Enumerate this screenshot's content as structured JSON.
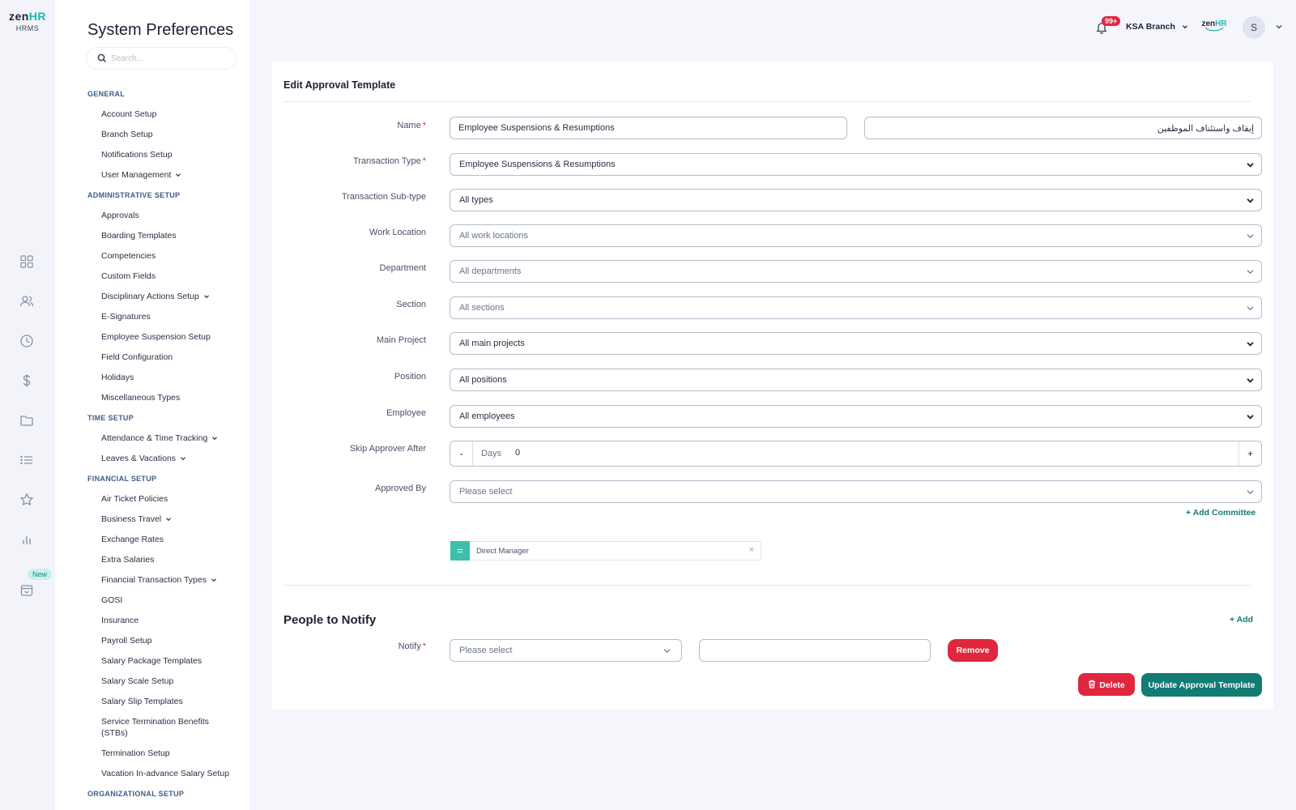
{
  "brand": {
    "logo_main": "zen",
    "logo_accent": "HR",
    "logo_sub": "HRMS",
    "accent_color": "#1bb8b0",
    "primary_button_color": "#127c74",
    "danger_color": "#e0273e"
  },
  "rail": {
    "icons": [
      "dashboard-icon",
      "people-icon",
      "clock-icon",
      "dollar-icon",
      "folder-icon",
      "list-icon",
      "star-icon",
      "bar-chart-icon",
      "inbox-icon"
    ],
    "new_badge": "New"
  },
  "settings": {
    "title": "System Preferences",
    "search_placeholder": "Search...",
    "sections": [
      {
        "heading": "GENERAL",
        "items": [
          {
            "label": "Account Setup"
          },
          {
            "label": "Branch Setup"
          },
          {
            "label": "Notifications Setup"
          },
          {
            "label": "User Management",
            "expandable": true
          }
        ]
      },
      {
        "heading": "ADMINISTRATIVE SETUP",
        "items": [
          {
            "label": "Approvals"
          },
          {
            "label": "Boarding Templates"
          },
          {
            "label": "Competencies"
          },
          {
            "label": "Custom Fields"
          },
          {
            "label": "Disciplinary Actions Setup",
            "expandable": true
          },
          {
            "label": "E-Signatures"
          },
          {
            "label": "Employee Suspension Setup"
          },
          {
            "label": "Field Configuration"
          },
          {
            "label": "Holidays"
          },
          {
            "label": "Miscellaneous Types"
          }
        ]
      },
      {
        "heading": "TIME SETUP",
        "items": [
          {
            "label": "Attendance & Time Tracking",
            "expandable": true
          },
          {
            "label": "Leaves & Vacations",
            "expandable": true
          }
        ]
      },
      {
        "heading": "FINANCIAL SETUP",
        "items": [
          {
            "label": "Air Ticket Policies"
          },
          {
            "label": "Business Travel",
            "expandable": true
          },
          {
            "label": "Exchange Rates"
          },
          {
            "label": "Extra Salaries"
          },
          {
            "label": "Financial Transaction Types",
            "expandable": true
          },
          {
            "label": "GOSI"
          },
          {
            "label": "Insurance"
          },
          {
            "label": "Payroll Setup"
          },
          {
            "label": "Salary Package Templates"
          },
          {
            "label": "Salary Scale Setup"
          },
          {
            "label": "Salary Slip Templates"
          },
          {
            "label": "Service Termination Benefits (STBs)",
            "multiline": true
          },
          {
            "label": "Termination Setup"
          },
          {
            "label": "Vacation In-advance Salary Setup"
          }
        ]
      },
      {
        "heading": "ORGANIZATIONAL SETUP",
        "items": []
      }
    ]
  },
  "header": {
    "notifications_badge": "99+",
    "branch_label": "KSA Branch",
    "avatar_initial": "S",
    "mini_logo_main": "zen",
    "mini_logo_accent": "HR"
  },
  "form": {
    "title": "Edit Approval Template",
    "fields": {
      "name": {
        "label": "Name",
        "required": true,
        "value": "Employee Suspensions & Resumptions",
        "value_ar": "إيقاف واستئناف الموظفين"
      },
      "transaction_type": {
        "label": "Transaction Type",
        "required": true,
        "value": "Employee Suspensions & Resumptions"
      },
      "transaction_subtype": {
        "label": "Transaction Sub-type",
        "value": "All types"
      },
      "work_location": {
        "label": "Work Location",
        "value": "All work locations"
      },
      "department": {
        "label": "Department",
        "value": "All departments"
      },
      "section": {
        "label": "Section",
        "value": "All sections"
      },
      "main_project": {
        "label": "Main Project",
        "value": "All main projects"
      },
      "position": {
        "label": "Position",
        "value": "All positions"
      },
      "employee": {
        "label": "Employee",
        "value": "All employees"
      },
      "skip_approver_after": {
        "label": "Skip Approver After",
        "minus": "-",
        "unit": "Days",
        "value": "0",
        "plus": "+"
      },
      "approved_by": {
        "label": "Approved By",
        "placeholder": "Please select"
      }
    },
    "add_committee": "+ Add Committee",
    "approvers": [
      {
        "handle": "=",
        "name": "Direct Manager",
        "remove": "×"
      }
    ]
  },
  "notify": {
    "title": "People to Notify",
    "add_label": "+ Add",
    "notify_label": "Notify",
    "notify_placeholder": "Please select",
    "remove_label": "Remove"
  },
  "actions": {
    "delete_label": "Delete",
    "update_label": "Update Approval Template"
  }
}
